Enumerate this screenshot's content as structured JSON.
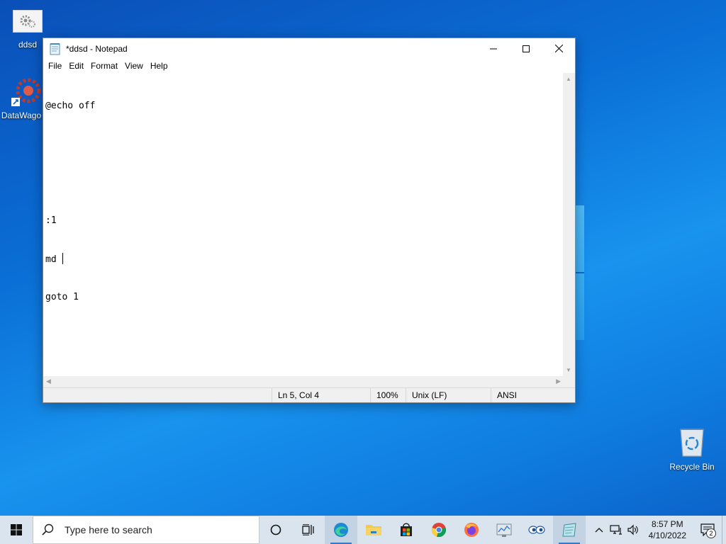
{
  "desktop": {
    "icons": [
      {
        "label": "ddsd"
      },
      {
        "label": "DataWago"
      },
      {
        "label": "Recycle Bin"
      }
    ]
  },
  "notepad": {
    "title": "*ddsd - Notepad",
    "menu": [
      "File",
      "Edit",
      "Format",
      "View",
      "Help"
    ],
    "lines": [
      "@echo off",
      "",
      "",
      ":1",
      "md ",
      "goto 1"
    ],
    "status": {
      "position": "Ln 5, Col 4",
      "zoom": "100%",
      "line_ending": "Unix (LF)",
      "encoding": "ANSI"
    }
  },
  "taskbar": {
    "search_placeholder": "Type here to search",
    "pinned": [
      "start-icon",
      "cortana-icon",
      "task-view-icon",
      "edge-icon",
      "file-explorer-icon",
      "store-icon",
      "chrome-icon",
      "firefox-icon",
      "app-icon",
      "eyes-app-icon",
      "notepad-icon"
    ],
    "clock": {
      "time": "8:57 PM",
      "date": "4/10/2022"
    },
    "notification_count": "2"
  },
  "colors": {
    "taskbar_bg": "#d9e4ef",
    "desktop_blue": "#0a6fd6",
    "accent": "#3a78c2"
  }
}
